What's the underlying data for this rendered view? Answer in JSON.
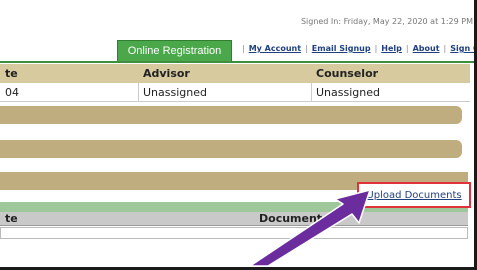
{
  "header": {
    "signed_in": "Signed In: Friday, May 22, 2020 at 1:29 PM"
  },
  "nav": {
    "registration_tab": "Online Registration",
    "separator": "|",
    "links": [
      "My Account",
      "Email Signup",
      "Help",
      "About",
      "Sign Out"
    ]
  },
  "advisor_table": {
    "columns": [
      "te",
      "Advisor",
      "Counselor"
    ],
    "row": [
      "04",
      "Unassigned",
      "Unassigned"
    ]
  },
  "upload": {
    "label": "Upload Documents"
  },
  "documents_table": {
    "columns": [
      "te",
      "Document"
    ]
  },
  "colors": {
    "header_tan": "#d6ca9e",
    "section_tan": "#bfad7f",
    "nav_green": "#4aa84a",
    "documents_green": "#9ec79a",
    "highlight_red": "#e0323a",
    "arrow_purple": "#6b2d9e"
  },
  "icons": {
    "annotation": "purple-arrow-icon"
  }
}
